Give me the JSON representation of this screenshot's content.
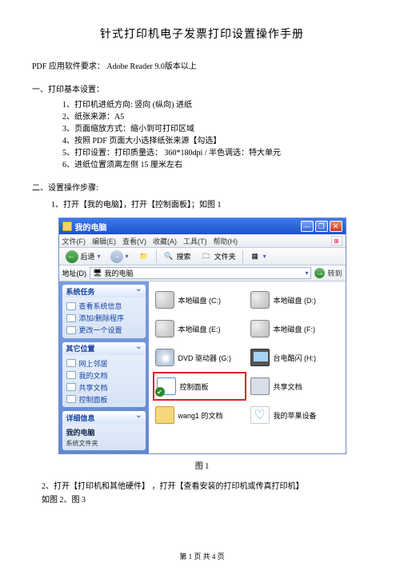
{
  "title": "针式打印机电子发票打印设置操作手册",
  "pdf_requirement_label": "PDF 应用软件要求：",
  "pdf_requirement_value": " Adobe Reader 9.0版本以上",
  "section1_title": "一、打印基本设置：",
  "basic_settings": {
    "i1": "1、打印机进纸方向: 竖向 (纵向) 进纸",
    "i2": "2、纸张来源：A5",
    "i3": "3、页面缩放方式：缩小到可打印区域",
    "i4": "4、按照 PDF 页面大小选择纸张来源【勾选】",
    "i5": "5、打印设置：打印质量选：  360*180dpi  / 半色调选：特大单元",
    "i6": "6、进纸位置须离左侧  15 厘米左右"
  },
  "section2_title": "二、设置操作步骤:",
  "step1": "1、打开【我的电脑】，打开【控制面板】；如图 1",
  "fig1_label": "图 1",
  "step2": "2、打开【打印机和其他硬件】  ，打开【查看安装的打印机或传真打印机】",
  "step3": "如图 2、图 3",
  "footer": "第 1 页 共 4 页",
  "win": {
    "title": "我的电脑",
    "menu": {
      "file": "文件(F)",
      "edit": "编辑(E)",
      "view": "查看(V)",
      "fav": "收藏(A)",
      "tools": "工具(T)",
      "help": "帮助(H)"
    },
    "toolbar": {
      "back": "后退",
      "search": "搜索",
      "folders": "文件夹"
    },
    "addrlabel": "地址(D)",
    "addrvalue": "我的电脑",
    "go": "转到",
    "panels": {
      "p1": "系统任务",
      "p2": "其它位置",
      "p3": "详细信息",
      "t1a": "查看系统信息",
      "t1b": "添加/删除程序",
      "t1c": "更改一个设置",
      "t2a": "网上邻居",
      "t2b": "我的文档",
      "t2c": "共享文档",
      "t2d": "控制面板",
      "t3a": "我的电脑",
      "t3b": "系统文件夹"
    },
    "items": {
      "d1": "本地磁盘 (C:)",
      "d2": "本地磁盘 (D:)",
      "d3": "本地磁盘 (E:)",
      "d4": "本地磁盘 (F:)",
      "d5": "DVD 驱动器 (G:)",
      "d6": "台电酷闪 (H:)",
      "d7": "控制面板",
      "d8": "共享文档",
      "d9": "wang1 的文档",
      "d10": "我的苹果设备"
    }
  }
}
